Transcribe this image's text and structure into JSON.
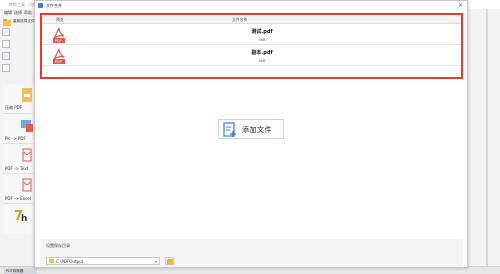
{
  "background_app": {
    "title": "转换工具 - 迅捷",
    "menu": [
      "编辑",
      "选择",
      "帮助"
    ],
    "toolbar_label": "重新选择文件",
    "tools": [
      {
        "label": "压缩 PDF",
        "icon": "compress-pdf-icon"
      },
      {
        "label": "Pic -> PDF",
        "icon": "image-to-pdf-icon"
      },
      {
        "label": "PDF -> Text",
        "icon": "pdf-to-text-icon"
      },
      {
        "label": "PDF -> Excel",
        "icon": "pdf-to-excel-icon"
      },
      {
        "label": "",
        "icon": "pdf-to-text-large-icon"
      }
    ],
    "taskbar_item": "PDF转换器"
  },
  "dialog": {
    "title": "文件合并",
    "close_label": "×",
    "columns": {
      "preview": "预览",
      "name": "文件名称"
    },
    "files": [
      {
        "name": "测试.pdf",
        "size": "9kB"
      },
      {
        "name": "副本.pdf",
        "size": "9kB"
      }
    ],
    "add_file_label": "添加文件",
    "output": {
      "label": "设置保存目录",
      "path": "C:\\PDFOutput",
      "dropdown_arrow": "▾"
    }
  },
  "colors": {
    "highlight_border": "#e53935",
    "pdf_red": "#e2574c",
    "accent_blue": "#3a7bd5",
    "folder_yellow": "#f2b632"
  }
}
